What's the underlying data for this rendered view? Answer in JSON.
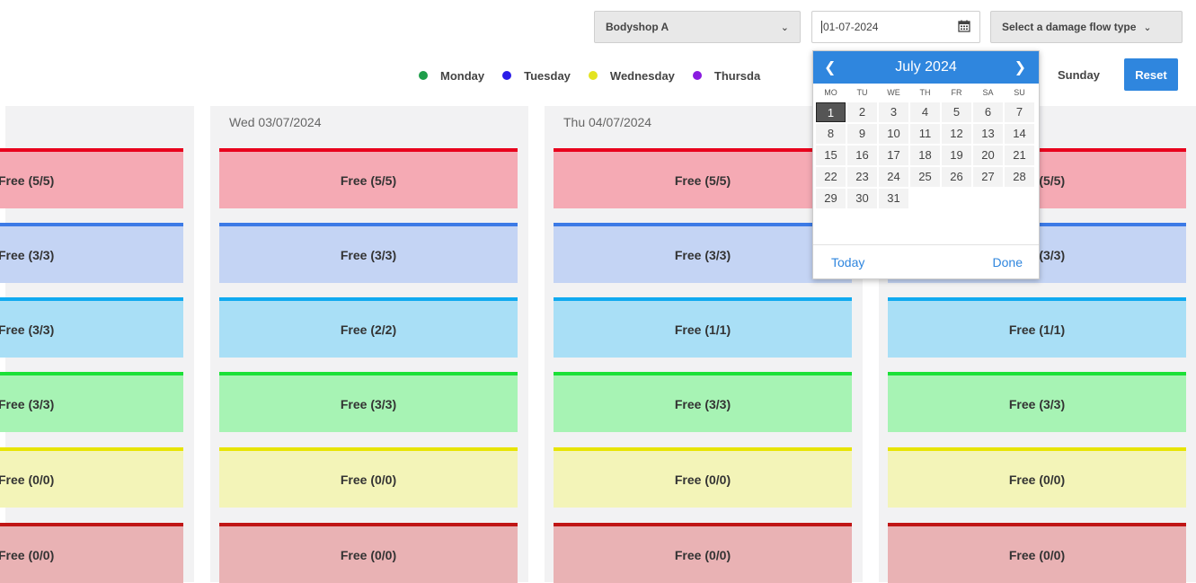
{
  "filters": {
    "bodyshop": "Bodyshop A",
    "date": "01-07-2024",
    "damage_flow_placeholder": "Select a damage flow type"
  },
  "legend": [
    {
      "label": "Monday",
      "color": "#1e9e4a"
    },
    {
      "label": "Tuesday",
      "color": "#2a1ce8"
    },
    {
      "label": "Wednesday",
      "color": "#e3e320"
    },
    {
      "label": "Thursda",
      "color": "#8a1be0"
    }
  ],
  "legend_sunday": "Sunday",
  "reset_label": "Reset",
  "columns": [
    {
      "header": "",
      "slots": [
        "Free (5/5)",
        "Free (3/3)",
        "Free (3/3)",
        "Free (3/3)",
        "Free (0/0)",
        "Free (0/0)"
      ]
    },
    {
      "header": "Wed 03/07/2024",
      "slots": [
        "Free (5/5)",
        "Free (3/3)",
        "Free (2/2)",
        "Free (3/3)",
        "Free (0/0)",
        "Free (0/0)"
      ]
    },
    {
      "header": "Thu 04/07/2024",
      "slots": [
        "Free (5/5)",
        "Free (3/3)",
        "Free (1/1)",
        "Free (3/3)",
        "Free (0/0)",
        "Free (0/0)"
      ]
    },
    {
      "header": "",
      "slots": [
        "Free (5/5)",
        "Free (3/3)",
        "Free (1/1)",
        "Free (3/3)",
        "Free (0/0)",
        "Free (0/0)"
      ]
    }
  ],
  "slot_colors": [
    {
      "fill": "#f5aab4",
      "border": "#e8001c"
    },
    {
      "fill": "#c4d4f4",
      "border": "#3c7ae6"
    },
    {
      "fill": "#a9dff6",
      "border": "#10aaf0"
    },
    {
      "fill": "#a7f3b4",
      "border": "#1be037"
    },
    {
      "fill": "#f3f4b8",
      "border": "#e7e400"
    },
    {
      "fill": "#e9b2b4",
      "border": "#c01515"
    }
  ],
  "datepicker": {
    "month_label": "July 2024",
    "weekdays": [
      "MO",
      "TU",
      "WE",
      "TH",
      "FR",
      "SA",
      "SU"
    ],
    "weeks": [
      [
        "1",
        "2",
        "3",
        "4",
        "5",
        "6",
        "7"
      ],
      [
        "8",
        "9",
        "10",
        "11",
        "12",
        "13",
        "14"
      ],
      [
        "15",
        "16",
        "17",
        "18",
        "19",
        "20",
        "21"
      ],
      [
        "22",
        "23",
        "24",
        "25",
        "26",
        "27",
        "28"
      ],
      [
        "29",
        "30",
        "31",
        "",
        "",
        "",
        ""
      ]
    ],
    "selected_day": "1",
    "today_label": "Today",
    "done_label": "Done"
  }
}
